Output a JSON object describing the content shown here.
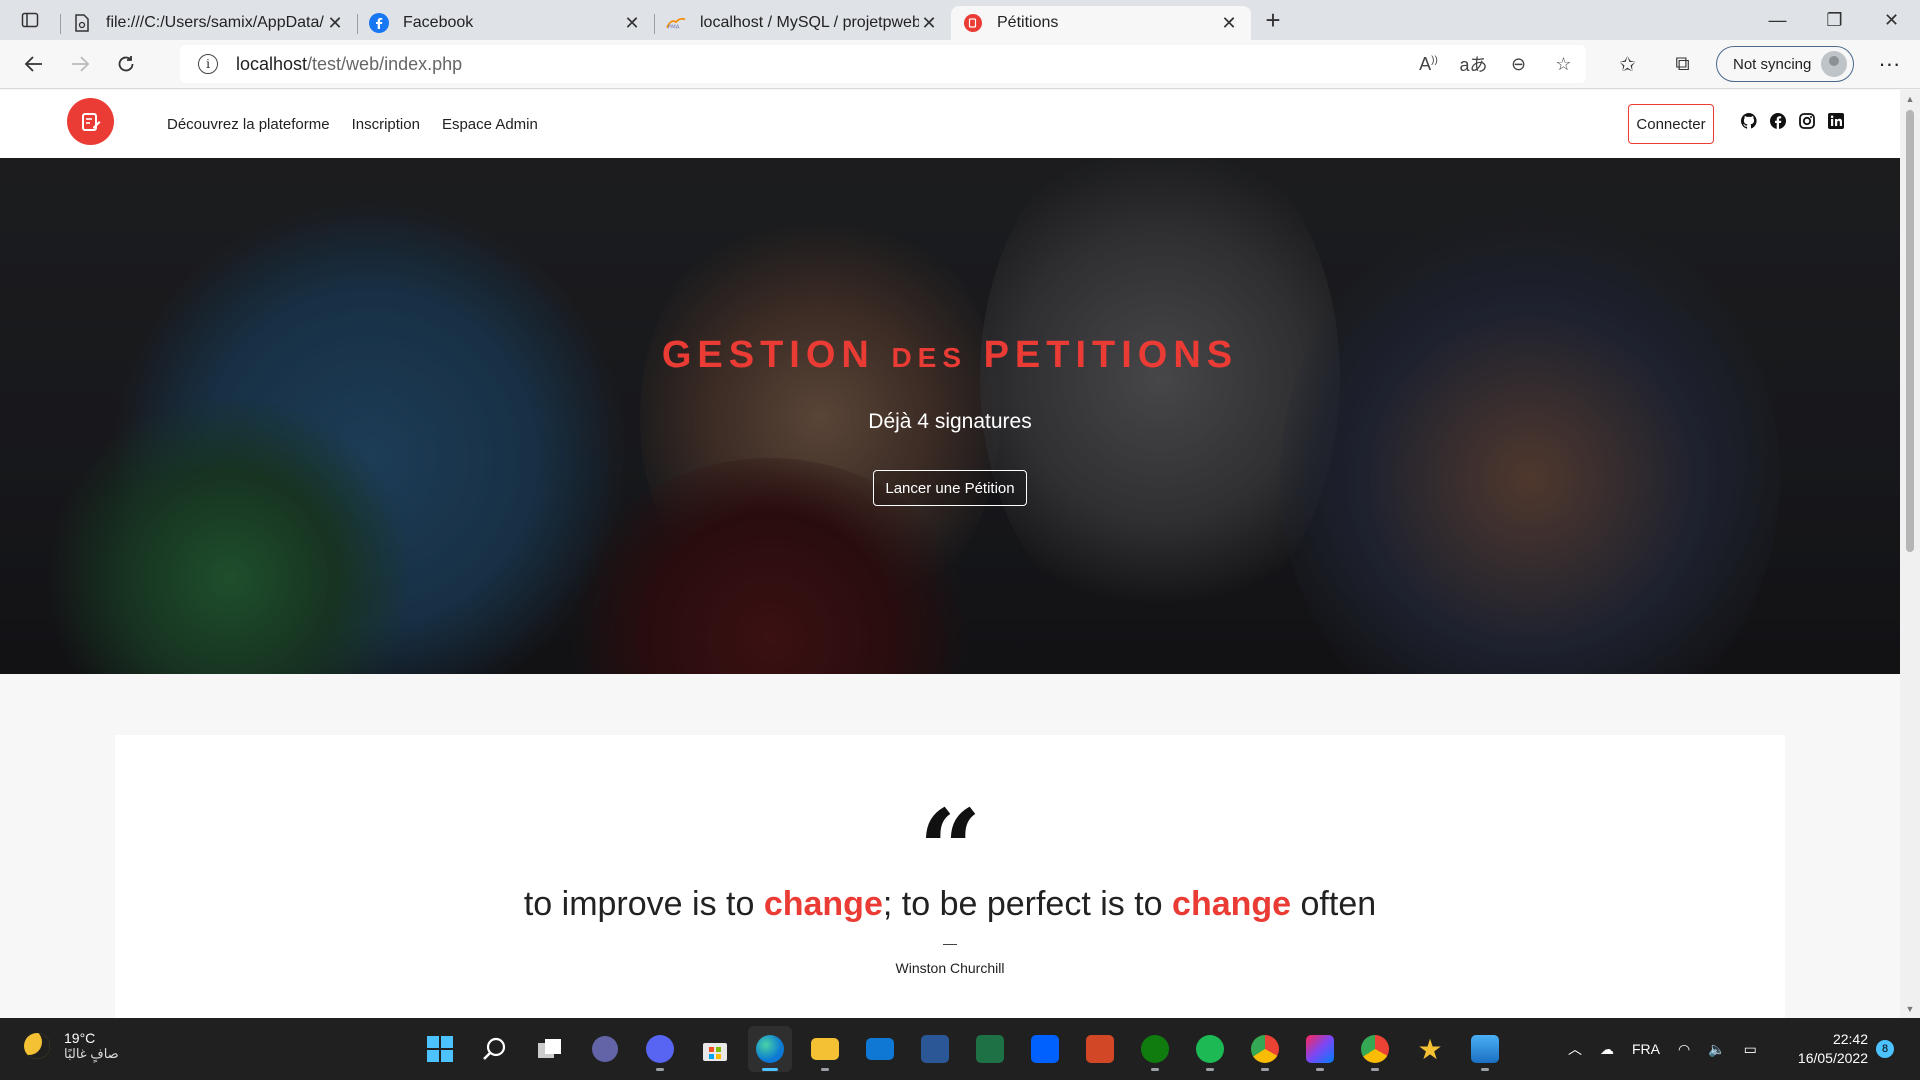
{
  "browser": {
    "tabs": [
      {
        "title": "file:///C:/Users/samix/AppData/L",
        "favicon": "file-icon"
      },
      {
        "title": "Facebook",
        "favicon": "facebook-icon"
      },
      {
        "title": "localhost / MySQL / projetpweb",
        "favicon": "phpmyadmin-icon"
      },
      {
        "title": "Pétitions",
        "favicon": "petition-icon",
        "active": true
      }
    ],
    "url_host": "localhost",
    "url_path": "/test/web/index.php",
    "sync_label": "Not syncing"
  },
  "site": {
    "nav": [
      "Découvrez la plateforme",
      "Inscription",
      "Espace Admin"
    ],
    "connect_label": "Connecter",
    "social_icons": [
      "github-icon",
      "facebook-icon",
      "instagram-icon",
      "linkedin-icon"
    ],
    "accent_color": "#ea3b35"
  },
  "hero": {
    "title_part1": "GESTION",
    "title_part2": "DES",
    "title_part3": "PETITIONS",
    "subtitle": "Déjà 4 signatures",
    "cta_label": "Lancer une Pétition"
  },
  "quote": {
    "part1": "to improve is to ",
    "hl1": "change",
    "part2": "; to be perfect is to ",
    "hl2": "change",
    "part3": " often",
    "dash": "—",
    "author": "Winston Churchill"
  },
  "taskbar": {
    "temperature": "19°C",
    "weather_text": "صافٍ غالبًا",
    "language": "FRA",
    "time": "22:42",
    "date": "16/05/2022",
    "notifications": "8"
  }
}
